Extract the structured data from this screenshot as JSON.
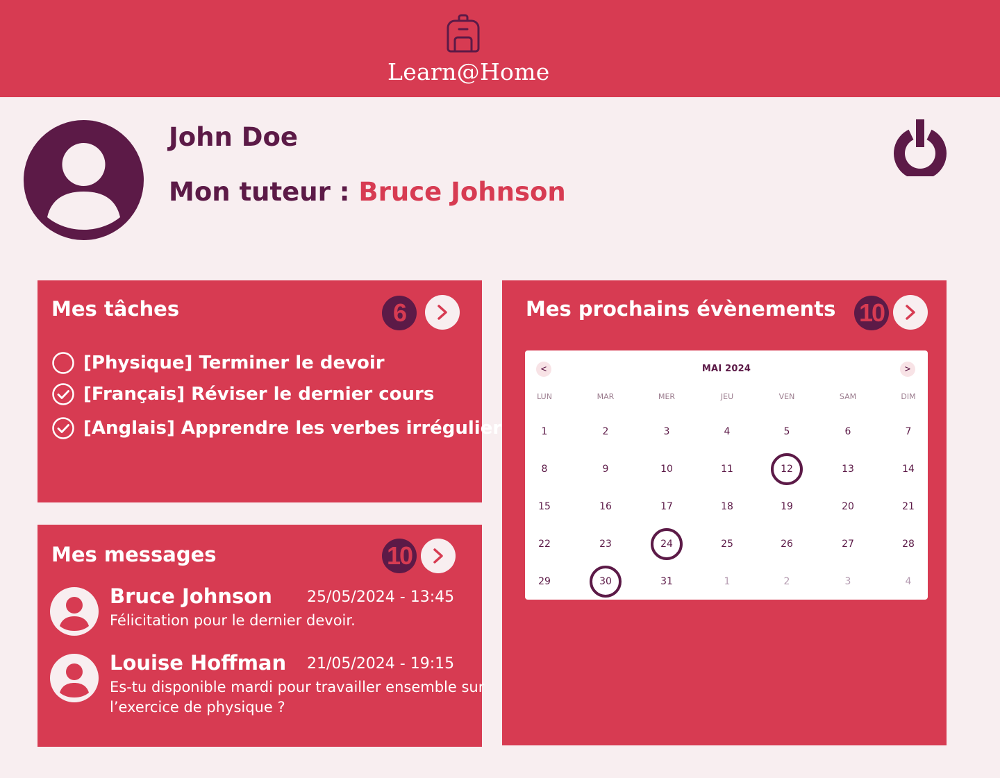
{
  "header": {
    "logo_text": "Learn@Home",
    "logo_icon": "backpack-icon"
  },
  "profile": {
    "name": "John Doe",
    "tutor_label": "Mon tuteur : ",
    "tutor_name": "Bruce Johnson",
    "avatar_icon": "user-avatar-icon",
    "logout_icon": "power-icon"
  },
  "tasks": {
    "title": "Mes tâches",
    "count": "6",
    "items": [
      {
        "label": "[Physique] Terminer le devoir",
        "done": false
      },
      {
        "label": "[Français] Réviser le dernier cours",
        "done": true
      },
      {
        "label": "[Anglais] Apprendre les verbes irréguliers",
        "done": true
      }
    ]
  },
  "messages": {
    "title": "Mes messages",
    "count": "10",
    "items": [
      {
        "from": "Bruce Johnson",
        "date": "25/05/2024 - 13:45",
        "text": "Félicitation pour le dernier devoir."
      },
      {
        "from": "Louise Hoffman",
        "date": "21/05/2024 - 19:15",
        "text": "Es-tu disponible mardi pour travailler ensemble sur l’exercice de physique ?"
      }
    ]
  },
  "events": {
    "title": "Mes prochains évènements",
    "count": "10",
    "calendar": {
      "month_label": "MAI 2024",
      "prev": "<",
      "next": ">",
      "weekdays": [
        "LUN",
        "MAR",
        "MER",
        "JEU",
        "VEN",
        "SAM",
        "DIM"
      ],
      "weeks": [
        [
          "1",
          "2",
          "3",
          "4",
          "5",
          "6",
          "7"
        ],
        [
          "8",
          "9",
          "10",
          "11",
          "12",
          "13",
          "14"
        ],
        [
          "15",
          "16",
          "17",
          "18",
          "19",
          "20",
          "21"
        ],
        [
          "22",
          "23",
          "24",
          "25",
          "26",
          "27",
          "28"
        ],
        [
          "29",
          "30",
          "31",
          "1",
          "2",
          "3",
          "4"
        ]
      ],
      "event_days": [
        "12",
        "24",
        "30"
      ],
      "trailing_other_month_count": 4
    }
  },
  "colors": {
    "accent": "#d73b52",
    "dark": "#5c1a47",
    "background": "#f8eef0"
  }
}
